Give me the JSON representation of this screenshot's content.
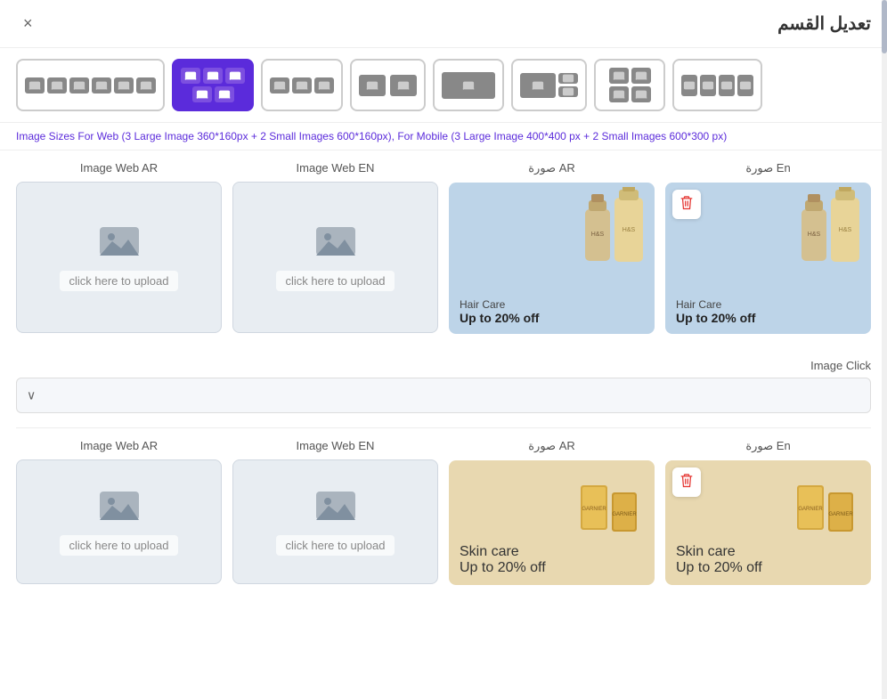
{
  "header": {
    "title": "تعديل القسم",
    "close_label": "×"
  },
  "info_text": "Image Sizes For Web (3 Large Image 360*160px + 2 Small Images 600*160px), For Mobile (3 Large Image 400*400 px + 2 Small Images 600*300 px)",
  "layouts": [
    {
      "id": "layout-1",
      "active": false,
      "icon_count": 6
    },
    {
      "id": "layout-2",
      "active": true,
      "icon_count": 5
    },
    {
      "id": "layout-3",
      "active": false,
      "icon_count": 3
    },
    {
      "id": "layout-4",
      "active": false,
      "icon_count": 2
    },
    {
      "id": "layout-5",
      "active": false,
      "icon_count": 2
    },
    {
      "id": "layout-6",
      "active": false,
      "icon_count": 1
    },
    {
      "id": "layout-7",
      "active": false,
      "icon_count": 3
    },
    {
      "id": "layout-8",
      "active": false,
      "icon_count": 4
    },
    {
      "id": "layout-9",
      "active": false,
      "icon_count": 4
    }
  ],
  "image_row_1": {
    "col1_label": "Image Web AR",
    "col2_label": "Image Web EN",
    "col3_label": "صورة AR",
    "col4_label": "صورة En",
    "upload_text_1": "click here to upload",
    "upload_text_2": "click here to upload",
    "preview1": {
      "category": "Hair Care",
      "promo": "Up to 20% off"
    },
    "preview2": {
      "category": "Hair Care",
      "promo": "Up to 20% off"
    }
  },
  "image_click": {
    "label": "Image Click",
    "dropdown_placeholder": "",
    "chevron": "∨"
  },
  "image_row_2": {
    "col1_label": "Image Web AR",
    "col2_label": "Image Web EN",
    "col3_label": "صورة AR",
    "col4_label": "صورة En",
    "upload_text_1": "click here to upload",
    "upload_text_2": "click here to upload",
    "preview1": {
      "category": "Skin care",
      "promo": "Up to 20% off"
    },
    "preview2": {
      "category": "Skin care",
      "promo": "Up to 20% off"
    }
  },
  "icons": {
    "camera": "📷",
    "mountain_image": "🖼",
    "trash": "🗑"
  },
  "colors": {
    "accent": "#5b2bdb",
    "delete_red": "#e53935",
    "upload_bg": "#e8edf2",
    "hair_care_bg": "#bdd4e8",
    "skin_care_bg": "#e8d8b0"
  }
}
